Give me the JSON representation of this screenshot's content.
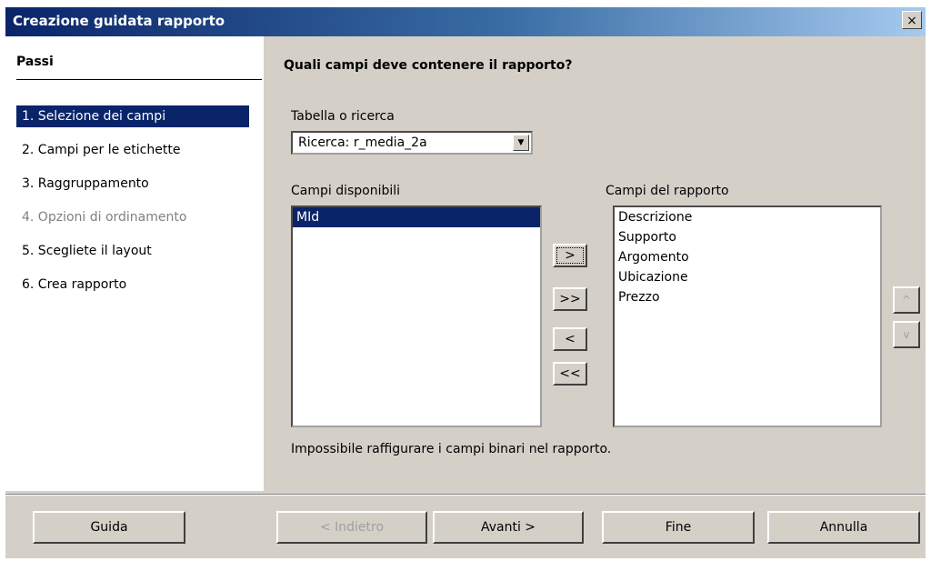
{
  "window": {
    "title": "Creazione guidata rapporto",
    "close_label": "×"
  },
  "steps": {
    "title": "Passi",
    "items": [
      {
        "label": "1. Selezione dei campi",
        "state": "selected"
      },
      {
        "label": "2. Campi per le etichette",
        "state": "normal"
      },
      {
        "label": "3. Raggruppamento",
        "state": "normal"
      },
      {
        "label": "4. Opzioni di ordinamento",
        "state": "disabled"
      },
      {
        "label": "5. Scegliete il layout",
        "state": "normal"
      },
      {
        "label": "6. Crea rapporto",
        "state": "normal"
      }
    ]
  },
  "main": {
    "heading": "Quali campi deve contenere il rapporto?",
    "table_label": "Tabella o ricerca",
    "table_value": "Ricerca: r_media_2a",
    "available_label": "Campi disponibili",
    "available_fields": [
      "MId"
    ],
    "report_label": "Campi del rapporto",
    "report_fields": [
      "Descrizione",
      "Supporto",
      "Argomento",
      "Ubicazione",
      "Prezzo"
    ],
    "move_buttons": {
      "add_one": ">",
      "add_all": ">>",
      "remove_one": "<",
      "remove_all": "<<"
    },
    "order_buttons": {
      "up": "^",
      "down": "v"
    },
    "note": "Impossibile raffigurare i campi binari nel rapporto."
  },
  "footer": {
    "help": "Guida",
    "back": "< Indietro",
    "next": "Avanti >",
    "finish": "Fine",
    "cancel": "Annulla"
  },
  "colors": {
    "selection": "#0a246a",
    "face": "#d4d0c8",
    "disabled_text": "#808080"
  }
}
